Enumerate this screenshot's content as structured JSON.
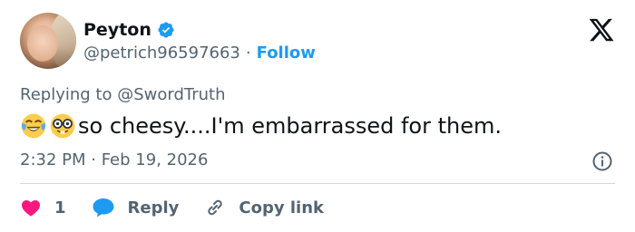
{
  "author": {
    "name": "Peyton",
    "handle": "@petrich96597663",
    "separator": "·",
    "follow_label": "Follow",
    "verified": true
  },
  "reply_context": {
    "prefix": "Replying to",
    "mention": "@SwordTruth"
  },
  "tweet": {
    "emojis": [
      "face-with-tears-of-joy",
      "nerd-face"
    ],
    "text": "so cheesy....I'm embarrassed for them."
  },
  "meta": {
    "timestamp": "2:32 PM · Feb 19, 2026"
  },
  "actions": {
    "like_count": "1",
    "reply_label": "Reply",
    "copy_link_label": "Copy link"
  },
  "colors": {
    "accent": "#1d9bf0",
    "like": "#f91880",
    "text": "#0f1419",
    "muted": "#536471"
  }
}
